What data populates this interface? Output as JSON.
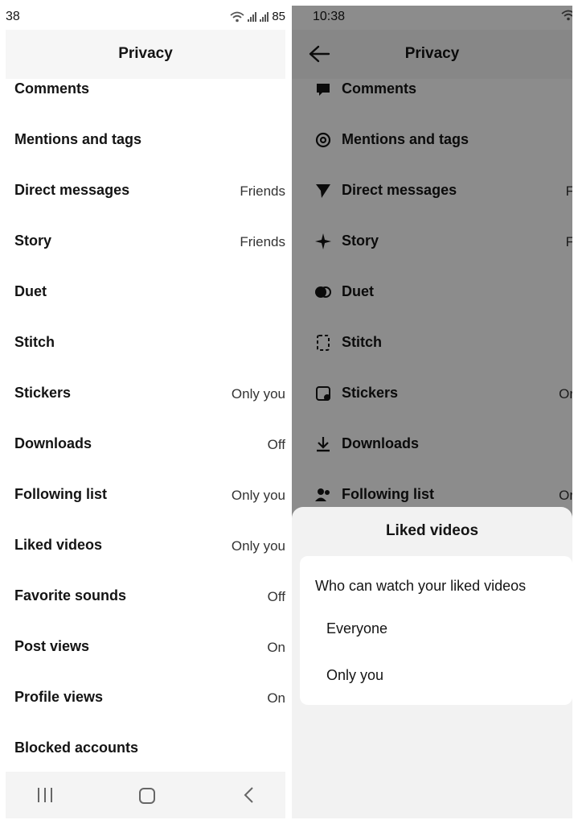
{
  "left": {
    "status": {
      "time": "38",
      "battery": "85"
    },
    "header": {
      "title": "Privacy"
    },
    "rows": [
      {
        "label": "Comments",
        "value": ""
      },
      {
        "label": "Mentions and tags",
        "value": ""
      },
      {
        "label": "Direct messages",
        "value": "Friends"
      },
      {
        "label": "Story",
        "value": "Friends"
      },
      {
        "label": "Duet",
        "value": ""
      },
      {
        "label": "Stitch",
        "value": ""
      },
      {
        "label": "Stickers",
        "value": "Only you"
      },
      {
        "label": "Downloads",
        "value": "Off"
      },
      {
        "label": "Following list",
        "value": "Only you"
      },
      {
        "label": "Liked videos",
        "value": "Only you"
      },
      {
        "label": "Favorite sounds",
        "value": "Off"
      },
      {
        "label": "Post views",
        "value": "On"
      },
      {
        "label": "Profile views",
        "value": "On"
      },
      {
        "label": "Blocked accounts",
        "value": ""
      }
    ]
  },
  "right": {
    "status": {
      "time": "10:38"
    },
    "header": {
      "title": "Privacy"
    },
    "rows": [
      {
        "label": "Comments",
        "value": "",
        "icon": "comment-icon"
      },
      {
        "label": "Mentions and tags",
        "value": "",
        "icon": "at-sign-icon"
      },
      {
        "label": "Direct messages",
        "value": "F",
        "icon": "send-icon"
      },
      {
        "label": "Story",
        "value": "F",
        "icon": "sparkle-icon"
      },
      {
        "label": "Duet",
        "value": "",
        "icon": "duet-icon"
      },
      {
        "label": "Stitch",
        "value": "",
        "icon": "stitch-icon"
      },
      {
        "label": "Stickers",
        "value": "Or",
        "icon": "sticker-icon"
      },
      {
        "label": "Downloads",
        "value": "",
        "icon": "download-icon"
      },
      {
        "label": "Following list",
        "value": "Or",
        "icon": "people-icon"
      }
    ],
    "sheet": {
      "title": "Liked videos",
      "question": "Who can watch your liked videos",
      "options": [
        "Everyone",
        "Only you"
      ]
    }
  }
}
